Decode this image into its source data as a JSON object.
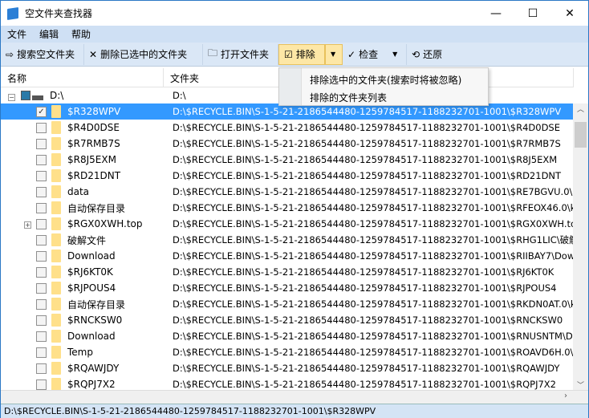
{
  "window": {
    "title": "空文件夹查找器",
    "minimize": "—",
    "maximize": "☐",
    "close": "✕"
  },
  "menu": [
    "文件",
    "编辑",
    "帮助"
  ],
  "toolbar": {
    "search": "搜索空文件夹",
    "delete": "删除已选中的文件夹",
    "open": "打开文件夹",
    "exclude": "排除",
    "check": "检查",
    "restore": "还原"
  },
  "dropdown": [
    "排除选中的文件夹(搜索时将被忽略)",
    "排除的文件夹列表"
  ],
  "columns": {
    "name": "名称",
    "folder": "文件夹"
  },
  "root": {
    "name": "D:\\",
    "path": "D:\\"
  },
  "rows": [
    {
      "name": "$R328WPV",
      "path": "D:\\$RECYCLE.BIN\\S-1-5-21-2186544480-1259784517-1188232701-1001\\$R328WPV",
      "checked": true,
      "selected": true
    },
    {
      "name": "$R4D0DSE",
      "path": "D:\\$RECYCLE.BIN\\S-1-5-21-2186544480-1259784517-1188232701-1001\\$R4D0DSE"
    },
    {
      "name": "$R7RMB7S",
      "path": "D:\\$RECYCLE.BIN\\S-1-5-21-2186544480-1259784517-1188232701-1001\\$R7RMB7S"
    },
    {
      "name": "$R8J5EXM",
      "path": "D:\\$RECYCLE.BIN\\S-1-5-21-2186544480-1259784517-1188232701-1001\\$R8J5EXM"
    },
    {
      "name": "$RD21DNT",
      "path": "D:\\$RECYCLE.BIN\\S-1-5-21-2186544480-1259784517-1188232701-1001\\$RD21DNT"
    },
    {
      "name": "data",
      "path": "D:\\$RECYCLE.BIN\\S-1-5-21-2186544480-1259784517-1188232701-1001\\$RE7BGVU.0\\.."
    },
    {
      "name": "自动保存目录",
      "path": "D:\\$RECYCLE.BIN\\S-1-5-21-2186544480-1259784517-1188232701-1001\\$RFEOX46.0\\k"
    },
    {
      "name": "$RGX0XWH.top",
      "path": "D:\\$RECYCLE.BIN\\S-1-5-21-2186544480-1259784517-1188232701-1001\\$RGX0XWH.to",
      "expandable": true
    },
    {
      "name": "破解文件",
      "path": "D:\\$RECYCLE.BIN\\S-1-5-21-2186544480-1259784517-1188232701-1001\\$RHG1LIC\\破解"
    },
    {
      "name": "Download",
      "path": "D:\\$RECYCLE.BIN\\S-1-5-21-2186544480-1259784517-1188232701-1001\\$RIIBAY7\\Dow"
    },
    {
      "name": "$RJ6KT0K",
      "path": "D:\\$RECYCLE.BIN\\S-1-5-21-2186544480-1259784517-1188232701-1001\\$RJ6KT0K"
    },
    {
      "name": "$RJPOUS4",
      "path": "D:\\$RECYCLE.BIN\\S-1-5-21-2186544480-1259784517-1188232701-1001\\$RJPOUS4"
    },
    {
      "name": "自动保存目录",
      "path": "D:\\$RECYCLE.BIN\\S-1-5-21-2186544480-1259784517-1188232701-1001\\$RKDN0AT.0\\k"
    },
    {
      "name": "$RNCKSW0",
      "path": "D:\\$RECYCLE.BIN\\S-1-5-21-2186544480-1259784517-1188232701-1001\\$RNCKSW0"
    },
    {
      "name": "Download",
      "path": "D:\\$RECYCLE.BIN\\S-1-5-21-2186544480-1259784517-1188232701-1001\\$RNUSNTM\\D"
    },
    {
      "name": "Temp",
      "path": "D:\\$RECYCLE.BIN\\S-1-5-21-2186544480-1259784517-1188232701-1001\\$ROAVD6H.0\\."
    },
    {
      "name": "$RQAWJDY",
      "path": "D:\\$RECYCLE.BIN\\S-1-5-21-2186544480-1259784517-1188232701-1001\\$RQAWJDY"
    },
    {
      "name": "$RQPJ7X2",
      "path": "D:\\$RECYCLE.BIN\\S-1-5-21-2186544480-1259784517-1188232701-1001\\$RQPJ7X2"
    }
  ],
  "status": "D:\\$RECYCLE.BIN\\S-1-5-21-2186544480-1259784517-1188232701-1001\\$R328WPV",
  "colors": {
    "selection": "#3399ff",
    "toolbar": "#dae7f6",
    "active_button": "#fde7a6"
  }
}
